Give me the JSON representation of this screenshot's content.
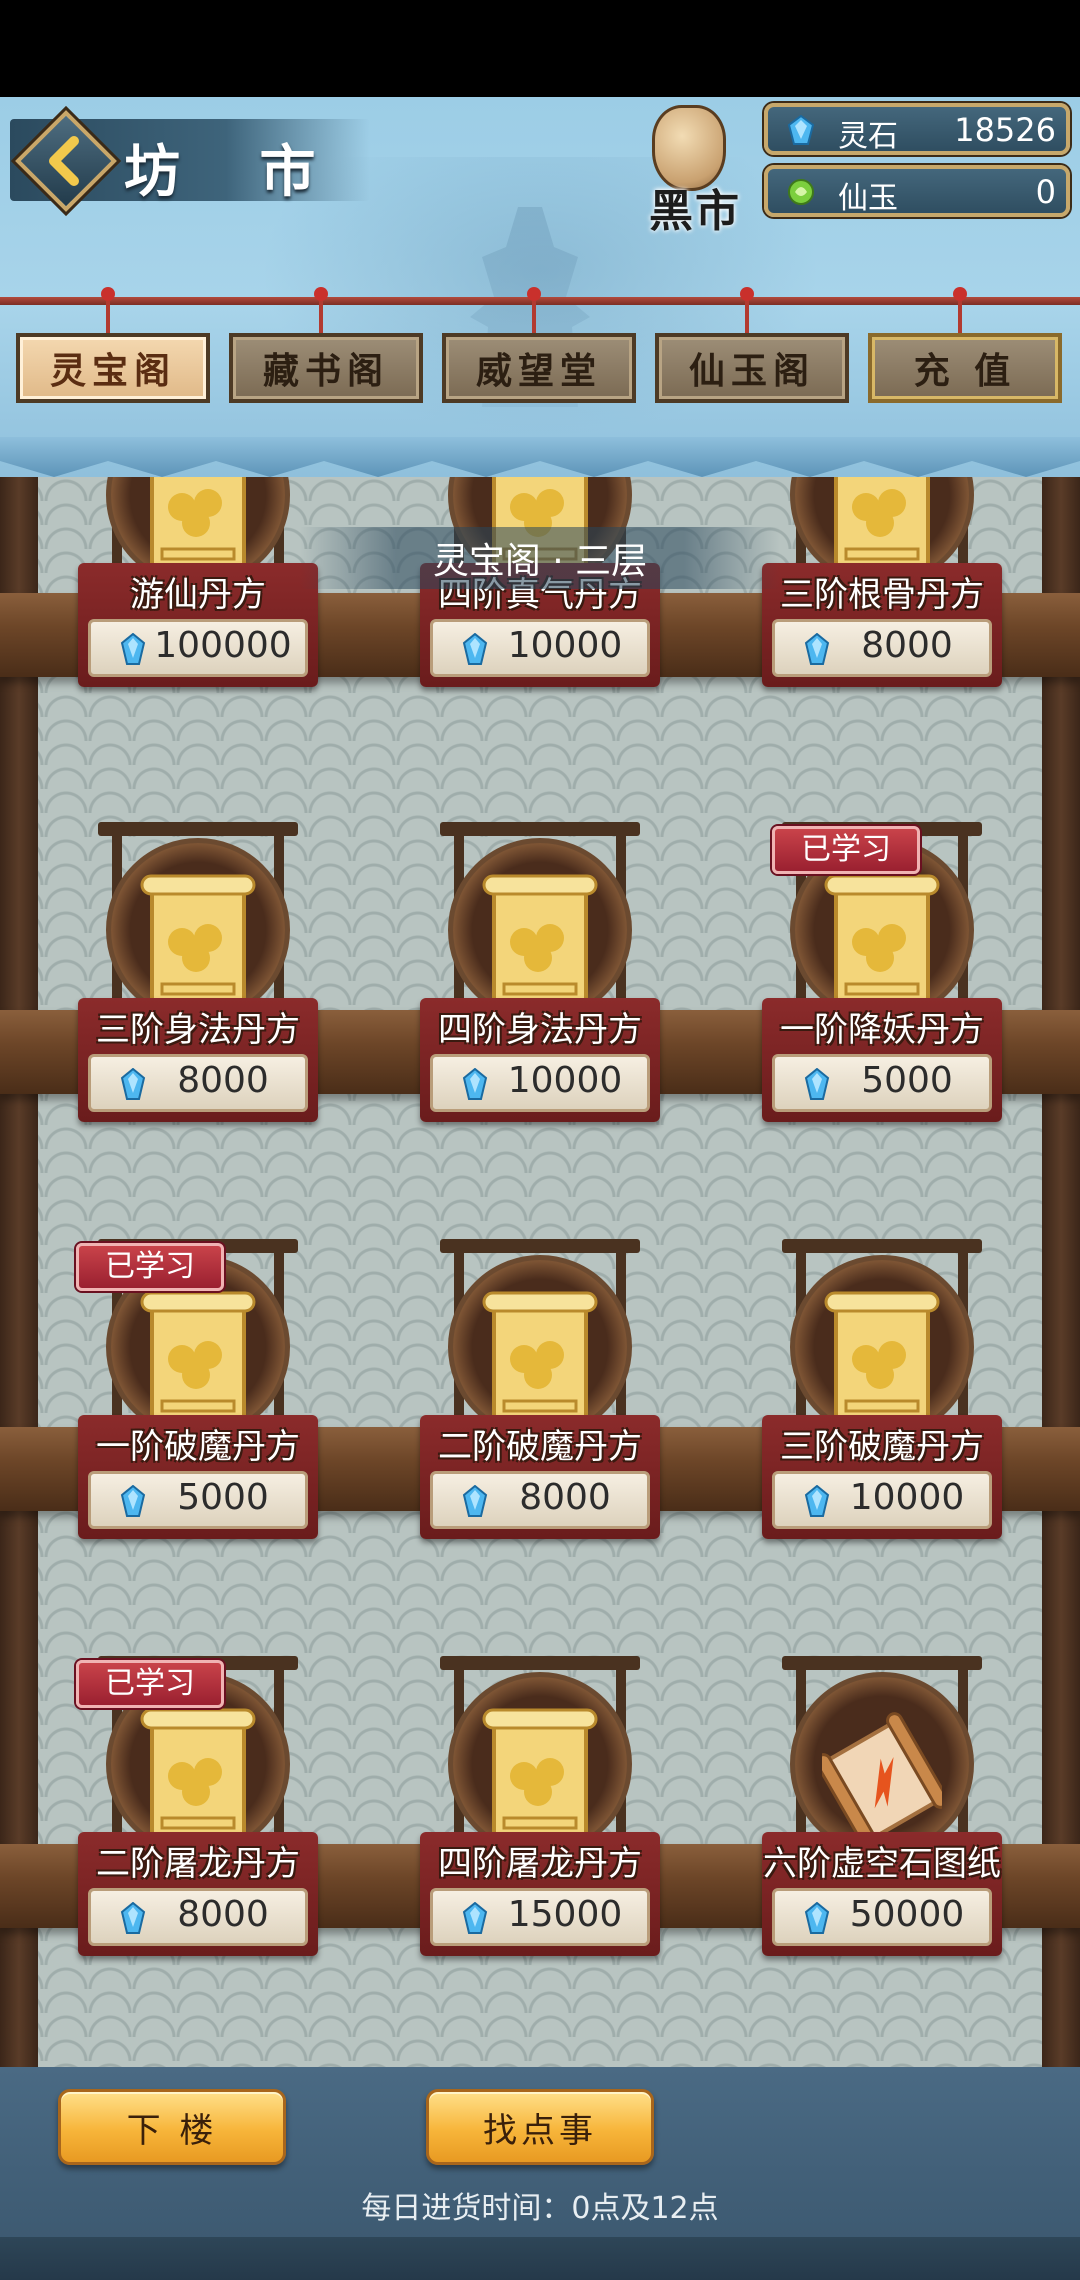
{
  "header": {
    "title": "坊 市",
    "black_market": "黑市",
    "currencies": [
      {
        "name": "灵石",
        "amount": "18526",
        "icon": "blue-gem-icon",
        "color": "#4db7f0"
      },
      {
        "name": "仙玉",
        "amount": "0",
        "icon": "green-jade-icon",
        "color": "#7ccf3e"
      }
    ]
  },
  "tabs": [
    {
      "label": "灵宝阁",
      "active": true
    },
    {
      "label": "藏书阁",
      "active": false
    },
    {
      "label": "威望堂",
      "active": false
    },
    {
      "label": "仙玉阁",
      "active": false
    },
    {
      "label": "充 值",
      "active": false
    }
  ],
  "floor_label": "灵宝阁 · 三层",
  "items": [
    {
      "name": "游仙丹方",
      "price": "100000",
      "learned": false,
      "icon": "recipe-scroll-icon"
    },
    {
      "name": "四阶真气丹方",
      "price": "10000",
      "learned": false,
      "icon": "recipe-scroll-icon"
    },
    {
      "name": "三阶根骨丹方",
      "price": "8000",
      "learned": false,
      "icon": "recipe-scroll-icon"
    },
    {
      "name": "三阶身法丹方",
      "price": "8000",
      "learned": false,
      "icon": "recipe-scroll-icon"
    },
    {
      "name": "四阶身法丹方",
      "price": "10000",
      "learned": false,
      "icon": "recipe-scroll-icon"
    },
    {
      "name": "一阶降妖丹方",
      "price": "5000",
      "learned": true,
      "icon": "recipe-scroll-icon"
    },
    {
      "name": "一阶破魔丹方",
      "price": "5000",
      "learned": true,
      "icon": "recipe-scroll-icon"
    },
    {
      "name": "二阶破魔丹方",
      "price": "8000",
      "learned": false,
      "icon": "recipe-scroll-icon"
    },
    {
      "name": "三阶破魔丹方",
      "price": "10000",
      "learned": false,
      "icon": "recipe-scroll-icon"
    },
    {
      "name": "二阶屠龙丹方",
      "price": "8000",
      "learned": true,
      "icon": "recipe-scroll-icon"
    },
    {
      "name": "四阶屠龙丹方",
      "price": "15000",
      "learned": false,
      "icon": "recipe-scroll-icon"
    },
    {
      "name": "六阶虚空石图纸",
      "price": "50000",
      "learned": false,
      "icon": "blueprint-scroll-icon"
    }
  ],
  "learned_label": "已学习",
  "footer": {
    "downstairs_label": "下 楼",
    "find_task_label": "找点事",
    "restock_text": "每日进货时间：0点及12点"
  }
}
